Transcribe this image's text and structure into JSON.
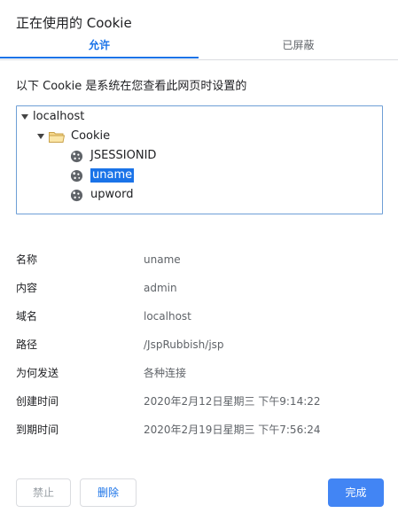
{
  "dialog": {
    "title": "正在使用的 Cookie"
  },
  "tabs": [
    {
      "label": "允许",
      "active": true
    },
    {
      "label": "已屏蔽",
      "active": false
    }
  ],
  "description": "以下 Cookie 是系统在您查看此网页时设置的",
  "tree": {
    "root": "localhost",
    "folder": "Cookie",
    "items": [
      "JSESSIONID",
      "uname",
      "upword"
    ],
    "selected": "uname"
  },
  "details": [
    {
      "key": "名称",
      "value": "uname"
    },
    {
      "key": "内容",
      "value": "admin"
    },
    {
      "key": "域名",
      "value": "localhost"
    },
    {
      "key": "路径",
      "value": "/JspRubbish/jsp"
    },
    {
      "key": "为何发送",
      "value": "各种连接"
    },
    {
      "key": "创建时间",
      "value": "2020年2月12日星期三 下午9:14:22"
    },
    {
      "key": "到期时间",
      "value": "2020年2月19日星期三 下午7:56:24"
    }
  ],
  "buttons": {
    "block": "禁止",
    "delete": "删除",
    "done": "完成"
  },
  "colors": {
    "accent": "#1a73e8",
    "primary_button": "#4285f4",
    "tree_border": "#6e9fd6"
  }
}
